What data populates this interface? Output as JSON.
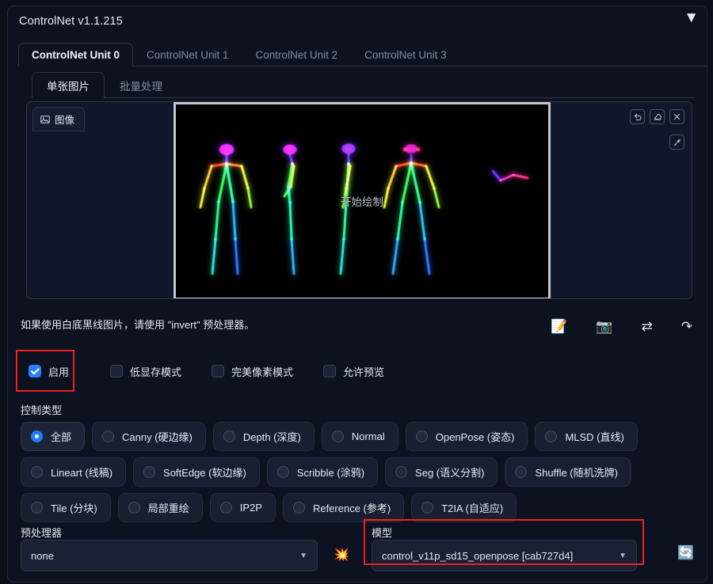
{
  "panel": {
    "title": "ControlNet v1.1.215",
    "caret": "▼"
  },
  "unit_tabs": [
    {
      "label": "ControlNet Unit 0",
      "active": true
    },
    {
      "label": "ControlNet Unit 1",
      "active": false
    },
    {
      "label": "ControlNet Unit 2",
      "active": false
    },
    {
      "label": "ControlNet Unit 3",
      "active": false
    }
  ],
  "sub_tabs": [
    {
      "label": "单张图片",
      "active": true
    },
    {
      "label": "批量处理",
      "active": false
    }
  ],
  "image_panel": {
    "tab_label": "图像",
    "tab_icon": "image-icon",
    "center_text": "开始绘制",
    "tools_row1": [
      {
        "name": "undo-icon",
        "title": "撤销"
      },
      {
        "name": "eraser-icon",
        "title": "擦除"
      },
      {
        "name": "close-icon",
        "title": "关闭"
      }
    ],
    "tools_row2": [
      {
        "name": "brush-icon",
        "title": "画笔"
      }
    ]
  },
  "hint": {
    "text": "如果使用白底黑线图片，请使用 \"invert\" 预处理器。"
  },
  "action_icons": [
    {
      "name": "memo-icon",
      "glyph": "📝"
    },
    {
      "name": "camera-icon",
      "glyph": "📷"
    },
    {
      "name": "swap-icon",
      "glyph": "⇄"
    },
    {
      "name": "send-icon",
      "glyph": "↷"
    }
  ],
  "checkboxes": [
    {
      "label": "启用",
      "checked": true,
      "highlighted": true
    },
    {
      "label": "低显存模式",
      "checked": false,
      "highlighted": false
    },
    {
      "label": "完美像素模式",
      "checked": false,
      "highlighted": false
    },
    {
      "label": "允许预览",
      "checked": false,
      "highlighted": false
    }
  ],
  "control_type": {
    "label": "控制类型",
    "options": [
      {
        "label": "全部",
        "selected": true
      },
      {
        "label": "Canny (硬边缘)",
        "selected": false
      },
      {
        "label": "Depth (深度)",
        "selected": false
      },
      {
        "label": "Normal",
        "selected": false
      },
      {
        "label": "OpenPose (姿态)",
        "selected": false
      },
      {
        "label": "MLSD (直线)",
        "selected": false
      },
      {
        "label": "Lineart (线稿)",
        "selected": false
      },
      {
        "label": "SoftEdge (软边缘)",
        "selected": false
      },
      {
        "label": "Scribble (涂鸦)",
        "selected": false
      },
      {
        "label": "Seg (语义分割)",
        "selected": false
      },
      {
        "label": "Shuffle (随机洗牌)",
        "selected": false
      },
      {
        "label": "Tile (分块)",
        "selected": false
      },
      {
        "label": "局部重绘",
        "selected": false
      },
      {
        "label": "IP2P",
        "selected": false
      },
      {
        "label": "Reference (参考)",
        "selected": false
      },
      {
        "label": "T2IA (自适应)",
        "selected": false
      }
    ]
  },
  "preprocessor": {
    "label": "预处理器",
    "value": "none",
    "caret": "▼"
  },
  "model": {
    "label": "模型",
    "value": "control_v11p_sd15_openpose [cab727d4]",
    "caret": "▼",
    "highlighted": true
  },
  "explode_button": {
    "name": "explosion-icon",
    "glyph": "💥"
  },
  "refresh_button": {
    "name": "refresh-icon",
    "glyph": "🔄"
  },
  "colors": {
    "background": "#0b0f19",
    "panel": "#0d1220",
    "border": "#2a3347",
    "accent": "#2a7fff",
    "highlight": "#f02020",
    "text": "#e4e9f1",
    "muted": "#7e8ba3"
  }
}
